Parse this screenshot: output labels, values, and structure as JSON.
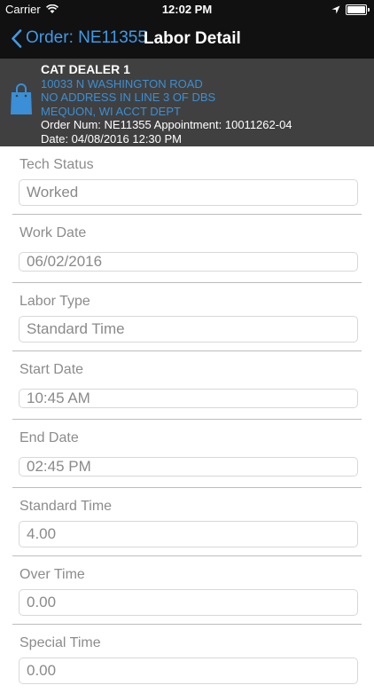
{
  "status_bar": {
    "carrier": "Carrier",
    "time": "12:02 PM"
  },
  "nav": {
    "back_label": "Order: NE11355",
    "title": "Labor Detail"
  },
  "header": {
    "dealer_name": "CAT DEALER 1",
    "address_line1": "10033 N WASHINGTON ROAD",
    "address_line2": "NO ADDRESS IN LINE 3 OF DBS",
    "address_line3": "MEQUON, WI ACCT DEPT",
    "order_line": "Order Num: NE11355 Appointment: 10011262-04",
    "date_line": "Date: 04/08/2016 12:30 PM"
  },
  "fields": [
    {
      "label": "Tech Status",
      "value": "Worked"
    },
    {
      "label": "Work Date",
      "value": "06/02/2016"
    },
    {
      "label": "Labor Type",
      "value": "Standard Time"
    },
    {
      "label": "Start Date",
      "value": "10:45 AM"
    },
    {
      "label": "End Date",
      "value": "02:45 PM"
    },
    {
      "label": "Standard Time",
      "value": "4.00"
    },
    {
      "label": "Over Time",
      "value": "0.00"
    },
    {
      "label": "Special Time",
      "value": "0.00"
    }
  ],
  "colors": {
    "accent": "#3d9be9",
    "header_bg": "#404040",
    "topbar_bg": "#111111",
    "address": "#3a8fd6"
  },
  "icons": [
    "wifi-icon",
    "location-arrow-icon",
    "battery-icon",
    "back-chevron-icon",
    "shopping-bag-icon"
  ]
}
